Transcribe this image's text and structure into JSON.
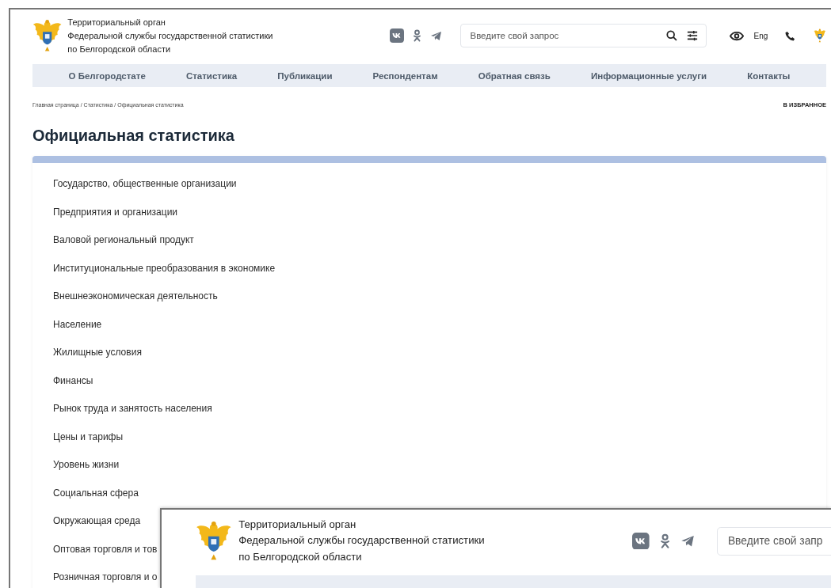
{
  "main_window": {
    "header": {
      "org_name_lines": [
        "Территориальный орган",
        "Федеральной службы государственной статистики",
        "по Белгородской области"
      ],
      "search": {
        "placeholder": "Введите свой запрос"
      },
      "language": "Eng"
    },
    "nav": [
      "О Белгородстате",
      "Статистика",
      "Публикации",
      "Респондентам",
      "Обратная связь",
      "Информационные услуги",
      "Контакты"
    ],
    "breadcrumb": "Главная страница / Статистика / Официальная статистика",
    "favorites": "В ИЗБРАННОЕ",
    "title": "Официальная статистика",
    "categories": [
      "Государство, общественные организации",
      "Предприятия и организации",
      "Валовой региональный продукт",
      "Институциональные преобразования в экономике",
      "Внешнеэкономическая деятельность",
      "Население",
      "Жилищные условия",
      "Финансы",
      "Рынок труда и занятость населения",
      "Цены и тарифы",
      "Уровень жизни",
      "Социальная сфера",
      "Окружающая среда",
      "Оптовая торговля и тов",
      "Розничная торговля и о"
    ]
  },
  "overlay_window": {
    "header": {
      "org_name_lines": [
        "Территориальный орган",
        "Федеральной службы государственной статистики",
        "по Белгородской области"
      ],
      "search": {
        "placeholder": "Введите свой запр"
      }
    }
  }
}
